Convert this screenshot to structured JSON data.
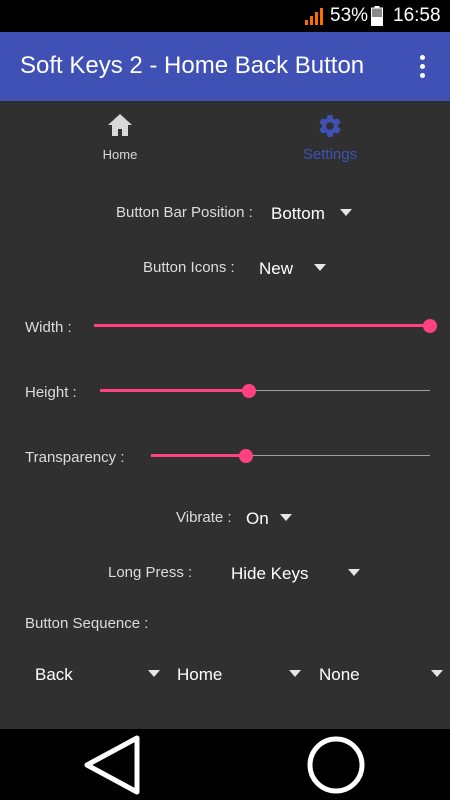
{
  "status_bar": {
    "battery_percent": "53%",
    "time": "16:58"
  },
  "app_bar": {
    "title": "Soft Keys 2 - Home Back Button",
    "overflow_icon": "more-vert-icon"
  },
  "tabs": [
    {
      "label": "Home",
      "icon": "home-icon",
      "selected": false
    },
    {
      "label": "Settings",
      "icon": "gear-icon",
      "selected": true
    }
  ],
  "settings": {
    "button_bar_position": {
      "label": "Button Bar Position :",
      "value": "Bottom"
    },
    "button_icons": {
      "label": "Button Icons :",
      "value": "New"
    },
    "width": {
      "label": "Width :",
      "level": 1.0
    },
    "height": {
      "label": "Height :",
      "level": 0.45
    },
    "transparency": {
      "label": "Transparency :",
      "level": 0.34
    },
    "vibrate": {
      "label": "Vibrate :",
      "value": "On"
    },
    "long_press": {
      "label": "Long Press :",
      "value": "Hide Keys"
    },
    "button_sequence": {
      "label": "Button Sequence :",
      "values": [
        "Back",
        "Home",
        "None"
      ]
    }
  },
  "colors": {
    "accent": "#ff4081",
    "primary": "#3f51b5",
    "background": "#303030"
  },
  "nav_bar": {
    "back_icon": "back-triangle-icon",
    "home_icon": "home-circle-icon"
  }
}
